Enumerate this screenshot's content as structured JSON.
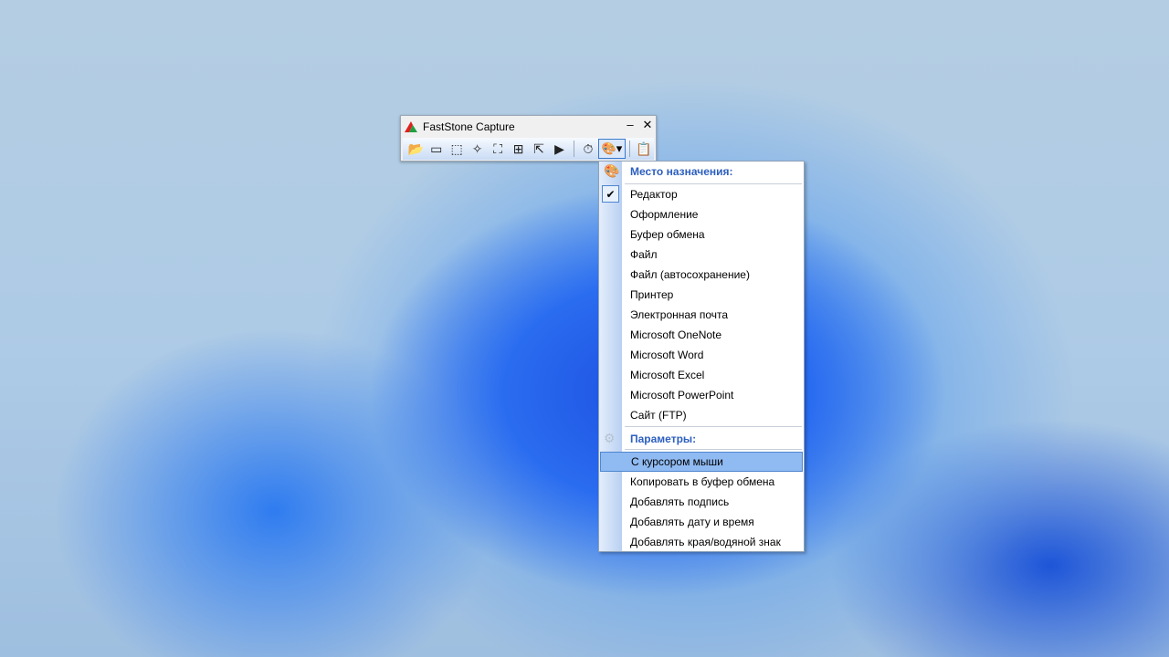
{
  "window": {
    "title": "FastStone Capture",
    "minimize": "–",
    "close": "✕"
  },
  "toolbar": {
    "icons": [
      "📂",
      "▭",
      "⬚",
      "✧",
      "⛶",
      "⊞",
      "⇱",
      "▶"
    ],
    "timer": "⏱",
    "dest": "🎨",
    "dest_arrow": "▾",
    "settings": "📋"
  },
  "menu": {
    "dest_header": "Место назначения:",
    "dest_items": [
      "Редактор",
      "Оформление",
      "Буфер обмена",
      "Файл",
      "Файл (автосохранение)",
      "Принтер",
      "Электронная почта",
      "Microsoft OneNote",
      "Microsoft Word",
      "Microsoft Excel",
      "Microsoft PowerPoint",
      "Сайт (FTP)"
    ],
    "checked": "✔",
    "params_header": "Параметры:",
    "param_items": [
      "С курсором мыши",
      "Копировать в буфер обмена",
      "Добавлять подпись",
      "Добавлять дату и время",
      "Добавлять края/водяной знак"
    ]
  }
}
